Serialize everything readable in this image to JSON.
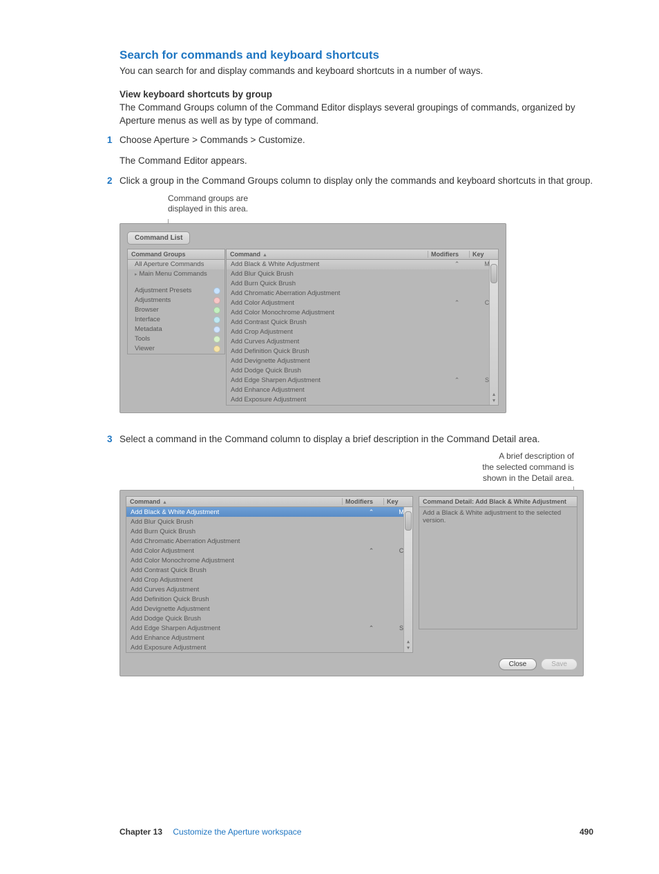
{
  "section_title": "Search for commands and keyboard shortcuts",
  "lead": "You can search for and display commands and keyboard shortcuts in a number of ways.",
  "sub_heading": "View keyboard shortcuts by group",
  "sub_body": "The Command Groups column of the Command Editor displays several groupings of commands, organized by Aperture menus as well as by type of command.",
  "steps": {
    "1": "Choose Aperture > Commands > Customize.",
    "1_after": "The Command Editor appears.",
    "2": "Click a group in the Command Groups column to display only the commands and keyboard shortcuts in that group.",
    "3": "Select a command in the Command column to display a brief description in the Command Detail area."
  },
  "fig1": {
    "caption_line1": "Command groups are",
    "caption_line2": "displayed in this area.",
    "tab_label": "Command List",
    "left_header": "Command Groups",
    "left_items": [
      {
        "label": "All Aperture Commands",
        "dot": ""
      },
      {
        "label": "Main Menu Commands",
        "dot": "",
        "disclosure": "▸"
      }
    ],
    "left_items2": [
      {
        "label": "Adjustment Presets",
        "dot": "#c7e3ff"
      },
      {
        "label": "Adjustments",
        "dot": "#f7c6c6"
      },
      {
        "label": "Browser",
        "dot": "#c3f0c0"
      },
      {
        "label": "Interface",
        "dot": "#bfe8f2"
      },
      {
        "label": "Metadata",
        "dot": "#cfe4ff"
      },
      {
        "label": "Tools",
        "dot": "#d7f2ca"
      },
      {
        "label": "Viewer",
        "dot": "#f6e3a7"
      }
    ],
    "right_header": {
      "command": "Command",
      "mod": "Modifiers",
      "key": "Key"
    },
    "right_rows": [
      {
        "c": "Add Black & White Adjustment",
        "m": "⌃",
        "k": "M",
        "sel": true
      },
      {
        "c": "Add Blur Quick Brush",
        "m": "",
        "k": ""
      },
      {
        "c": "Add Burn Quick Brush",
        "m": "",
        "k": ""
      },
      {
        "c": "Add Chromatic Aberration Adjustment",
        "m": "",
        "k": ""
      },
      {
        "c": "Add Color Adjustment",
        "m": "⌃",
        "k": "C"
      },
      {
        "c": "Add Color Monochrome Adjustment",
        "m": "",
        "k": ""
      },
      {
        "c": "Add Contrast Quick Brush",
        "m": "",
        "k": ""
      },
      {
        "c": "Add Crop Adjustment",
        "m": "",
        "k": ""
      },
      {
        "c": "Add Curves Adjustment",
        "m": "",
        "k": ""
      },
      {
        "c": "Add Definition Quick Brush",
        "m": "",
        "k": ""
      },
      {
        "c": "Add Devignette Adjustment",
        "m": "",
        "k": ""
      },
      {
        "c": "Add Dodge Quick Brush",
        "m": "",
        "k": ""
      },
      {
        "c": "Add Edge Sharpen Adjustment",
        "m": "⌃",
        "k": "S"
      },
      {
        "c": "Add Enhance Adjustment",
        "m": "",
        "k": ""
      },
      {
        "c": "Add Exposure Adjustment",
        "m": "",
        "k": ""
      }
    ]
  },
  "fig2": {
    "caption_line1": "A brief description of",
    "caption_line2": "the selected command is",
    "caption_line3": "shown in the Detail area.",
    "left_header": {
      "command": "Command",
      "mod": "Modifiers",
      "key": "Key"
    },
    "rows": [
      {
        "c": "Add Black & White Adjustment",
        "m": "⌃",
        "k": "M",
        "sel": true
      },
      {
        "c": "Add Blur Quick Brush",
        "m": "",
        "k": ""
      },
      {
        "c": "Add Burn Quick Brush",
        "m": "",
        "k": ""
      },
      {
        "c": "Add Chromatic Aberration Adjustment",
        "m": "",
        "k": ""
      },
      {
        "c": "Add Color Adjustment",
        "m": "⌃",
        "k": "C"
      },
      {
        "c": "Add Color Monochrome Adjustment",
        "m": "",
        "k": ""
      },
      {
        "c": "Add Contrast Quick Brush",
        "m": "",
        "k": ""
      },
      {
        "c": "Add Crop Adjustment",
        "m": "",
        "k": ""
      },
      {
        "c": "Add Curves Adjustment",
        "m": "",
        "k": ""
      },
      {
        "c": "Add Definition Quick Brush",
        "m": "",
        "k": ""
      },
      {
        "c": "Add Devignette Adjustment",
        "m": "",
        "k": ""
      },
      {
        "c": "Add Dodge Quick Brush",
        "m": "",
        "k": ""
      },
      {
        "c": "Add Edge Sharpen Adjustment",
        "m": "⌃",
        "k": "S"
      },
      {
        "c": "Add Enhance Adjustment",
        "m": "",
        "k": ""
      },
      {
        "c": "Add Exposure Adjustment",
        "m": "",
        "k": ""
      }
    ],
    "detail_title": "Command Detail: Add Black & White Adjustment",
    "detail_body": "Add a Black & White adjustment to the selected version.",
    "close_btn": "Close",
    "save_btn": "Save"
  },
  "footer": {
    "chapter": "Chapter 13",
    "title": "Customize the Aperture workspace",
    "page": "490"
  }
}
